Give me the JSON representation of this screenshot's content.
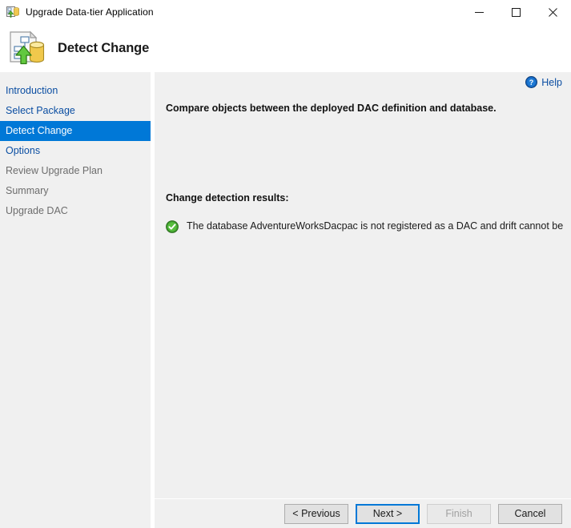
{
  "window": {
    "title": "Upgrade Data-tier Application",
    "app_icon": "upgrade-dac-icon",
    "controls": {
      "minimize": "minimize-icon",
      "maximize": "maximize-icon",
      "close": "close-icon"
    }
  },
  "header": {
    "icon": "detect-change-icon",
    "title": "Detect Change"
  },
  "sidebar": {
    "items": [
      {
        "label": "Introduction",
        "state": "link"
      },
      {
        "label": "Select Package",
        "state": "link"
      },
      {
        "label": "Detect Change",
        "state": "active"
      },
      {
        "label": "Options",
        "state": "link"
      },
      {
        "label": "Review Upgrade Plan",
        "state": "disabled"
      },
      {
        "label": "Summary",
        "state": "disabled"
      },
      {
        "label": "Upgrade DAC",
        "state": "disabled"
      }
    ]
  },
  "content": {
    "help": {
      "icon": "help-icon",
      "label": "Help"
    },
    "instruction": "Compare objects between the deployed DAC definition and database.",
    "results_label": "Change detection results:",
    "result": {
      "icon": "success-check-icon",
      "text": "The database AdventureWorksDacpac is not registered as a DAC and drift cannot be"
    }
  },
  "footer": {
    "buttons": [
      {
        "label": "< Previous",
        "state": "enabled"
      },
      {
        "label": "Next >",
        "state": "default"
      },
      {
        "label": "Finish",
        "state": "disabled"
      },
      {
        "label": "Cancel",
        "state": "enabled"
      }
    ]
  },
  "colors": {
    "accent": "#0078d7",
    "link": "#0b4ea2",
    "panel_bg": "#f0f0f0",
    "success": "#4caf50",
    "window_bg": "#ffffff"
  }
}
